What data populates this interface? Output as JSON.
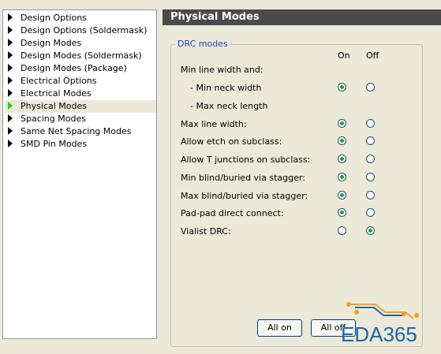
{
  "tree": {
    "items": [
      {
        "label": "Design Options"
      },
      {
        "label": "Design Options (Soldermask)"
      },
      {
        "label": "Design Modes"
      },
      {
        "label": "Design Modes (Soldermask)"
      },
      {
        "label": "Design Modes (Package)"
      },
      {
        "label": "Electrical Options"
      },
      {
        "label": "Electrical Modes"
      },
      {
        "label": "Physical Modes",
        "selected": true
      },
      {
        "label": "Spacing Modes"
      },
      {
        "label": "Same Net Spacing Modes"
      },
      {
        "label": "SMD Pin Modes"
      }
    ]
  },
  "header": {
    "title": "Physical Modes"
  },
  "group": {
    "title": "DRC modes",
    "col_on": "On",
    "col_off": "Off",
    "rows": [
      {
        "label": "Min line width and:"
      },
      {
        "label": "- Min neck width",
        "value": "on"
      },
      {
        "label": "- Max neck length"
      },
      {
        "label": "Max line width:",
        "value": "on"
      },
      {
        "label": "Allow etch on subclass:",
        "value": "on"
      },
      {
        "label": "Allow T junctions on subclass:",
        "value": "on"
      },
      {
        "label": "Min blind/buried via stagger:",
        "value": "on"
      },
      {
        "label": "Max blind/buried via stagger:",
        "value": "on"
      },
      {
        "label": "Pad-pad direct connect:",
        "value": "on"
      },
      {
        "label": "Vialist DRC:",
        "value": "off"
      }
    ]
  },
  "buttons": {
    "all_on": "All on",
    "all_off": "All off"
  },
  "watermark": {
    "text": "EDA365"
  },
  "colors": {
    "header_bg": "#4a4a4a",
    "radio_dot": "#21a121",
    "group_title": "#1a47b8",
    "watermark": "#1a66b3",
    "logo_accent": "#f0a020"
  }
}
